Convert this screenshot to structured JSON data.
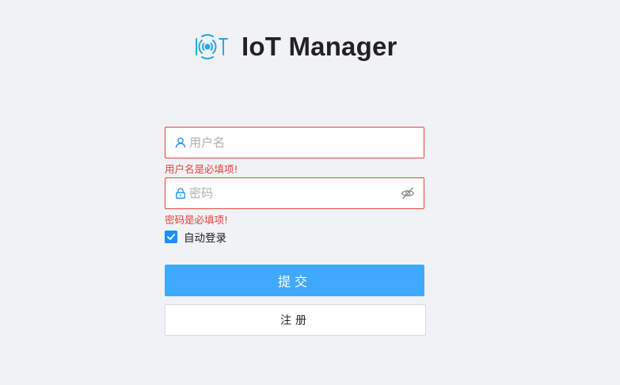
{
  "brand": {
    "title": "IoT Manager",
    "logo_icon": "iot-signal-logo",
    "logo_letter": "T",
    "logo_color": "#2aa6e8"
  },
  "form": {
    "username": {
      "placeholder": "用户名",
      "value": "",
      "icon": "user-icon",
      "error": "用户名是必填项!"
    },
    "password": {
      "placeholder": "密码",
      "value": "",
      "icon": "lock-icon",
      "toggle_icon": "eye-hidden-icon",
      "error": "密码是必填项!"
    },
    "remember": {
      "label": "自动登录",
      "checked": true
    },
    "submit_label": "提交",
    "register_label": "注册"
  },
  "colors": {
    "background": "#f0f2f5",
    "error": "#e6433b",
    "primary": "#40a9ff",
    "icon_blue": "#1890ff"
  }
}
